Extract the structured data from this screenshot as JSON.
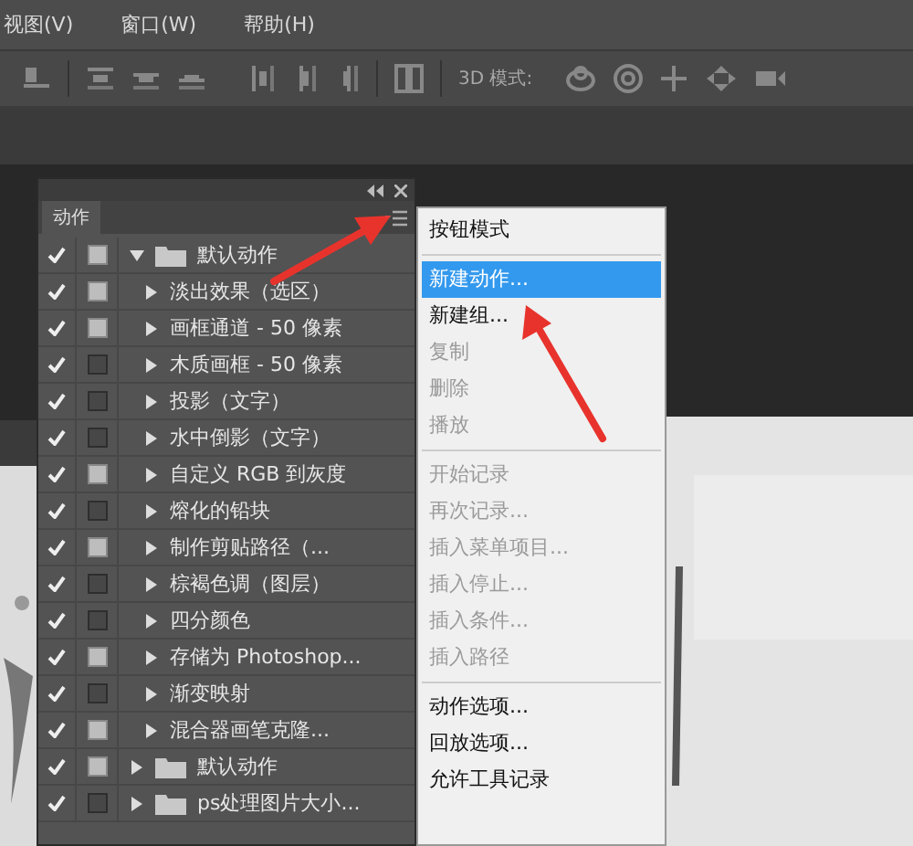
{
  "menu_bar": [
    {
      "label": "视图(V)"
    },
    {
      "label": "窗口(W)"
    },
    {
      "label": "帮助(H)"
    }
  ],
  "toolbar": {
    "mode_label": "3D 模式:"
  },
  "actions_panel": {
    "tab": "动作",
    "items": [
      {
        "name": "默认动作",
        "kind": "set",
        "checked": true,
        "dialog": true,
        "expanded": true,
        "children": [
          {
            "name": "淡出效果（选区）",
            "kind": "action",
            "checked": true,
            "dialog": true
          },
          {
            "name": "画框通道 - 50 像素",
            "kind": "action",
            "checked": true,
            "dialog": true
          },
          {
            "name": "木质画框 - 50 像素",
            "kind": "action",
            "checked": true,
            "dialog": false
          },
          {
            "name": "投影（文字）",
            "kind": "action",
            "checked": true,
            "dialog": false
          },
          {
            "name": "水中倒影（文字）",
            "kind": "action",
            "checked": true,
            "dialog": false
          },
          {
            "name": "自定义 RGB 到灰度",
            "kind": "action",
            "checked": true,
            "dialog": true
          },
          {
            "name": "熔化的铅块",
            "kind": "action",
            "checked": true,
            "dialog": false
          },
          {
            "name": "制作剪贴路径（...",
            "kind": "action",
            "checked": true,
            "dialog": true
          },
          {
            "name": "棕褐色调（图层）",
            "kind": "action",
            "checked": true,
            "dialog": false
          },
          {
            "name": "四分颜色",
            "kind": "action",
            "checked": true,
            "dialog": false
          },
          {
            "name": "存储为 Photoshop...",
            "kind": "action",
            "checked": true,
            "dialog": true
          },
          {
            "name": "渐变映射",
            "kind": "action",
            "checked": true,
            "dialog": false
          },
          {
            "name": "混合器画笔克隆...",
            "kind": "action",
            "checked": true,
            "dialog": true
          }
        ]
      },
      {
        "name": "默认动作",
        "kind": "set",
        "checked": true,
        "dialog": true,
        "expanded": false
      },
      {
        "name": "ps处理图片大小...",
        "kind": "set",
        "checked": true,
        "dialog": false,
        "expanded": false
      }
    ]
  },
  "panel_menu": {
    "items": [
      {
        "kind": "item",
        "label": "按钮模式",
        "disabled": false,
        "selected": false
      },
      {
        "kind": "separator"
      },
      {
        "kind": "item",
        "label": "新建动作...",
        "disabled": false,
        "selected": true
      },
      {
        "kind": "item",
        "label": "新建组...",
        "disabled": false,
        "selected": false
      },
      {
        "kind": "item",
        "label": "复制",
        "disabled": true,
        "selected": false
      },
      {
        "kind": "item",
        "label": "删除",
        "disabled": true,
        "selected": false
      },
      {
        "kind": "item",
        "label": "播放",
        "disabled": true,
        "selected": false
      },
      {
        "kind": "separator"
      },
      {
        "kind": "item",
        "label": "开始记录",
        "disabled": true,
        "selected": false
      },
      {
        "kind": "item",
        "label": "再次记录...",
        "disabled": true,
        "selected": false
      },
      {
        "kind": "item",
        "label": "插入菜单项目...",
        "disabled": true,
        "selected": false
      },
      {
        "kind": "item",
        "label": "插入停止...",
        "disabled": true,
        "selected": false
      },
      {
        "kind": "item",
        "label": "插入条件...",
        "disabled": true,
        "selected": false
      },
      {
        "kind": "item",
        "label": "插入路径",
        "disabled": true,
        "selected": false
      },
      {
        "kind": "separator"
      },
      {
        "kind": "item",
        "label": "动作选项...",
        "disabled": false,
        "selected": false
      },
      {
        "kind": "item",
        "label": "回放选项...",
        "disabled": false,
        "selected": false
      },
      {
        "kind": "item",
        "label": "允许工具记录",
        "disabled": false,
        "selected": false
      }
    ]
  }
}
